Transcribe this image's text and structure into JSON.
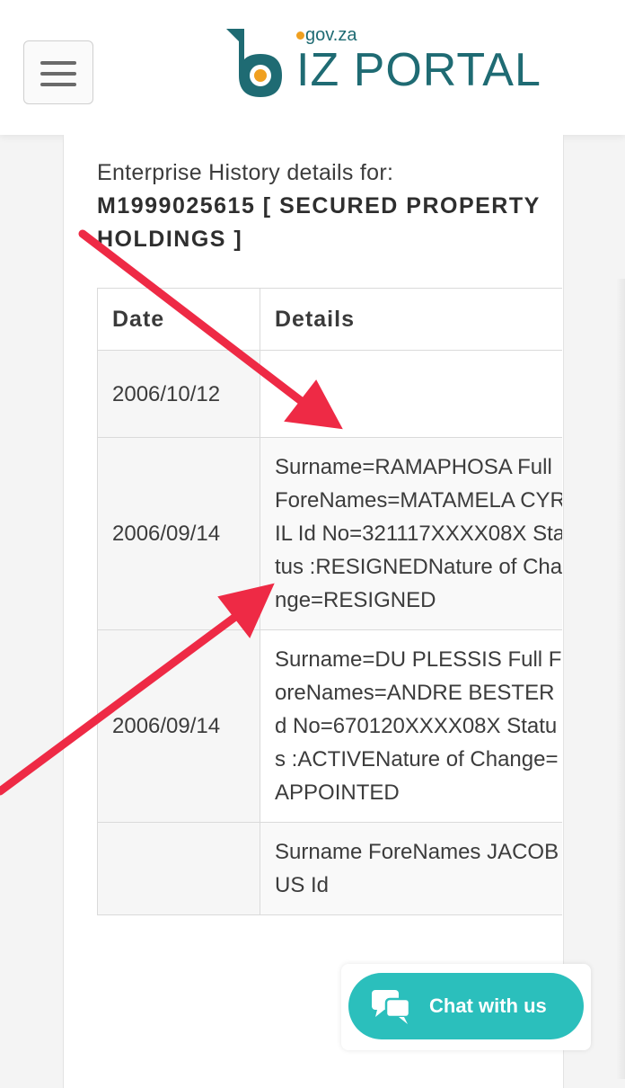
{
  "header": {
    "menu_icon": "hamburger-icon",
    "logo": {
      "brand": "IZ PORTAL",
      "domain": "gov.za",
      "mark_icon": "biz-b-logo-icon",
      "colors": {
        "brand": "#1f6b73",
        "dot": "#f0a020"
      }
    }
  },
  "page": {
    "heading_line1": "Enterprise History details for:",
    "heading_id": "M1999025615 [ SECURED PROPERTY HOLDINGS ]"
  },
  "history_table": {
    "columns": [
      "Date",
      "Details"
    ],
    "rows": [
      {
        "date": "2006/10/12",
        "details": ""
      },
      {
        "date": "2006/09/14",
        "details": "Surname=RAMAPHOSA Full ForeNames=MATAMELA CYRIL Id No=321117XXXX08X Status :RESIGNEDNature of Change=RESIGNED"
      },
      {
        "date": "2006/09/14",
        "details": "Surname=DU PLESSIS Full ForeNames=ANDRE BESTER Id No=670120XXXX08X Status :ACTIVENature of Change=APPOINTED"
      },
      {
        "date": "",
        "details": "Surname ForeNames JACOBUS Id"
      }
    ]
  },
  "chat": {
    "label": "Chat with us",
    "icon": "chat-bubbles-icon",
    "color": "#2bbfbc"
  },
  "annotations": {
    "arrow_color": "#ee2a45",
    "arrow_icon": "red-arrow-annotation"
  }
}
